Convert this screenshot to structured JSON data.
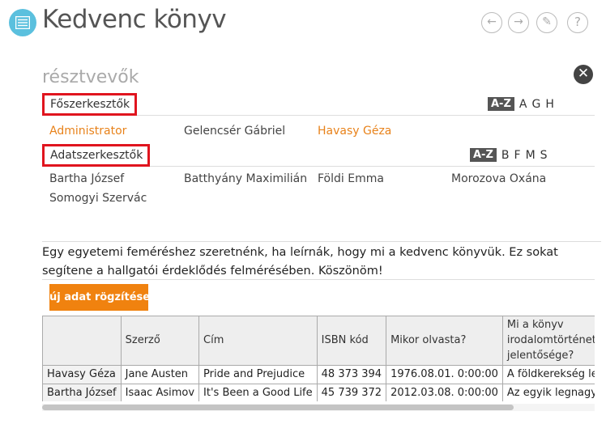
{
  "app": {
    "title": "Kedvenc könyv"
  },
  "toolbar": {
    "back_glyph": "←",
    "forward_glyph": "→",
    "edit_glyph": "✎",
    "help_glyph": "?"
  },
  "participants": {
    "title": "résztvevők",
    "close_glyph": "✕",
    "chief_editors": {
      "label": "Főszerkesztők",
      "sort_az": "A-Z",
      "letters": [
        "A",
        "G",
        "H"
      ],
      "people": [
        "Administrator",
        "Gelencsér Gábriel",
        "Havasy Géza"
      ]
    },
    "data_editors": {
      "label": "Adatszerkesztők",
      "sort_az": "A-Z",
      "letters": [
        "B",
        "F",
        "M",
        "S"
      ],
      "people": [
        "Bartha József",
        "Batthyány Maximilián",
        "Földi Emma",
        "Morozova Oxána",
        "Somogyi Szervác"
      ]
    }
  },
  "description": "Egy egyetemi feméréshez szeretnénk, ha leírnák, hogy mi a kedvenc könyvük. Ez sokat segítene a hallgatói érdeklődés felmérésében. Köszönöm!",
  "new_entry_button": "új adat rögzítése",
  "table": {
    "headers": [
      "",
      "Szerző",
      "Cím",
      "ISBN kód",
      "Mikor olvasta?",
      "Mi a könyv irodalomtörténeti jelentősége?"
    ],
    "rows": [
      [
        "Havasy Géza",
        "Jane Austen",
        "Pride and Prejudice",
        "48 373 394",
        "1976.08.01. 0:00:00",
        "A földkerekség legsze…"
      ],
      [
        "Bartha József",
        "Isaac Asimov",
        "It's Been a Good Life",
        "45 739 372",
        "2012.03.08. 0:00:00",
        "Az egyik legnagyobb h…"
      ]
    ]
  },
  "colors": {
    "accent_orange": "#f0820f",
    "admin_orange": "#e8821a",
    "highlight_red": "#e0141e",
    "app_icon_blue": "#5bc0de"
  }
}
